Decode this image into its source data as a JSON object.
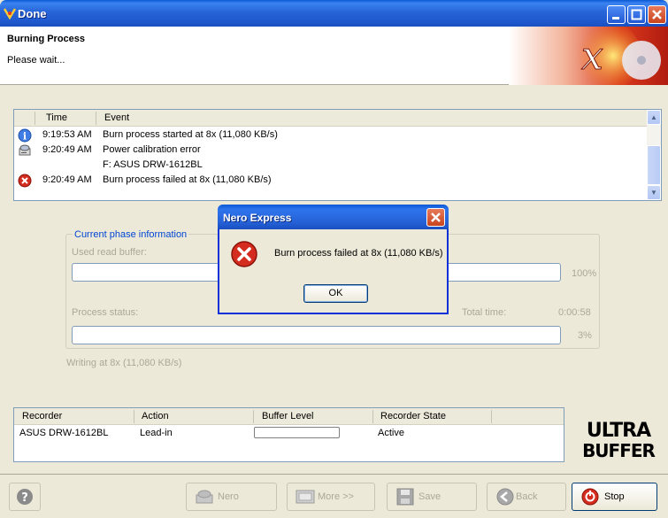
{
  "window": {
    "title": "Done"
  },
  "header": {
    "title": "Burning Process",
    "subtitle": "Please wait..."
  },
  "log": {
    "columns": [
      "Time",
      "Event"
    ],
    "rows": [
      {
        "icon": "info-icon",
        "time": "9:19:53 AM",
        "event": "Burn process started at 8x (11,080 KB/s)"
      },
      {
        "icon": "drive-icon",
        "time": "9:20:49 AM",
        "event": "Power calibration error"
      },
      {
        "icon": "",
        "time": "",
        "event": "F: ASUS DRW-1612BL"
      },
      {
        "icon": "error-icon",
        "time": "9:20:49 AM",
        "event": "Burn process failed at 8x (11,080 KB/s)"
      }
    ]
  },
  "phase": {
    "legend": "Current phase information",
    "used_read_buffer_label": "Used read buffer:",
    "buffer_percent": "100%",
    "process_status_label": "Process status:",
    "total_time_label": "Total time:",
    "total_time_value": "0:00:58",
    "status_percent": "3%",
    "writing_label": "Writing at 8x (11,080 KB/s)"
  },
  "recorder": {
    "columns": [
      "Recorder",
      "Action",
      "Buffer Level",
      "Recorder State"
    ],
    "row": {
      "recorder": "ASUS DRW-1612BL",
      "action": "Lead-in",
      "buffer_level": 0,
      "state": "Active"
    }
  },
  "buttons": {
    "nero": "Nero",
    "more": "More >>",
    "save": "Save",
    "back": "Back",
    "stop": "Stop"
  },
  "dialog": {
    "title": "Nero Express",
    "message": "Burn process failed at 8x (11,080 KB/s)",
    "ok": "OK"
  },
  "colors": {
    "titlebar": "#2764d8",
    "error": "#d42c1e",
    "link_blue": "#0046d5"
  }
}
